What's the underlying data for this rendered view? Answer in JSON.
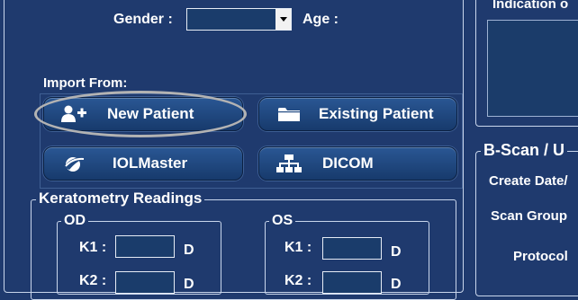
{
  "patient": {
    "gender_label": "Gender :",
    "gender_value": "",
    "age_label": "Age :"
  },
  "import": {
    "label": "Import From:",
    "new_patient": "New Patient",
    "existing_patient": "Existing Patient",
    "iolmaster": "IOLMaster",
    "dicom": "DICOM"
  },
  "keratometry": {
    "title": "Keratometry Readings",
    "od": {
      "title": "OD",
      "k1_label": "K1 :",
      "k1_value": "",
      "k1_unit": "D",
      "k2_label": "K2 :",
      "k2_unit": "D"
    },
    "os": {
      "title": "OS",
      "k1_label": "K1 :",
      "k1_value": "",
      "k1_unit": "D",
      "k2_label": "K2 :",
      "k2_unit": "D"
    }
  },
  "right_panel": {
    "indication_label": "Indication o",
    "bscan_title": "B-Scan / U",
    "create_date_label": "Create Date/",
    "scan_group_label": "Scan Group",
    "protocol_label": "Protocol"
  },
  "icons": {
    "new_patient": "add-user-icon",
    "existing_patient": "folder-icon",
    "iolmaster": "iolmaster-icon",
    "dicom": "network-icon"
  },
  "colors": {
    "background": "#1f3a6e",
    "button": "#214a82",
    "field": "#1a3c6b"
  }
}
